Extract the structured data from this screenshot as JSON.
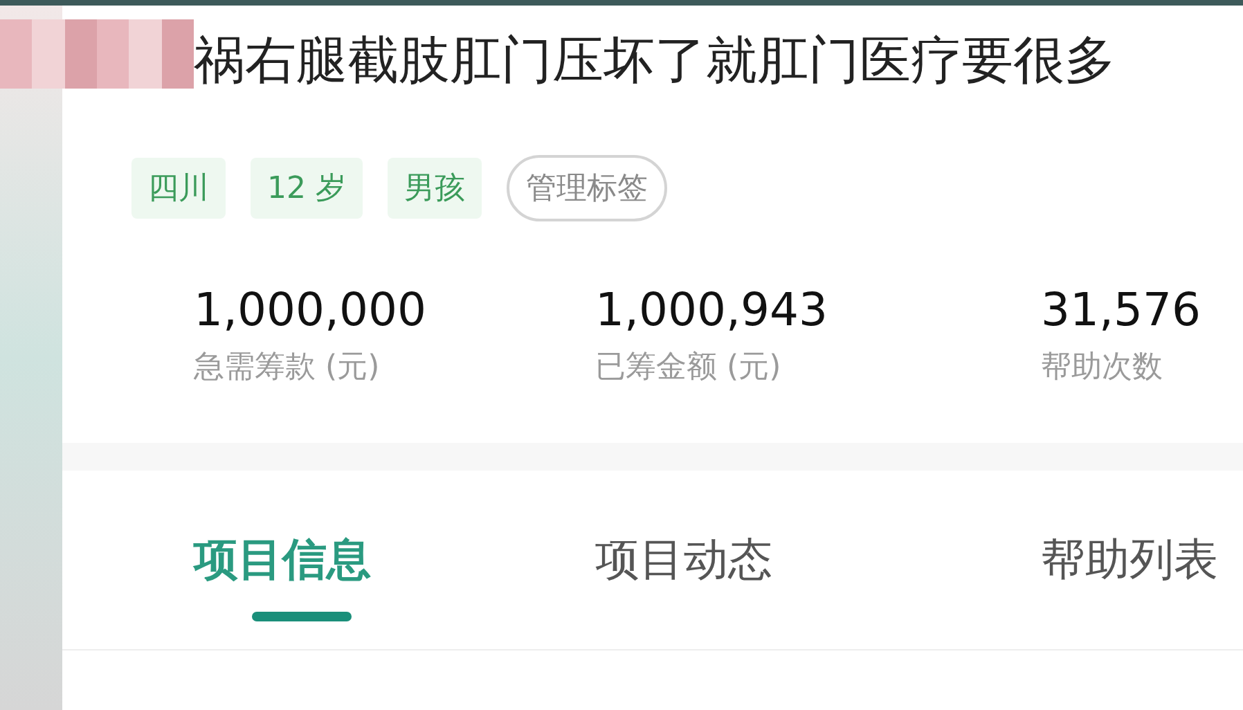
{
  "title": "祸右腿截肢肛门压坏了就肛门医疗要很多",
  "tags": [
    {
      "label": "四川",
      "kind": "info"
    },
    {
      "label": "12 岁",
      "kind": "info"
    },
    {
      "label": "男孩",
      "kind": "info"
    },
    {
      "label": "管理标签",
      "kind": "action"
    }
  ],
  "stats": [
    {
      "value": "1,000,000",
      "label": "急需筹款 (元)"
    },
    {
      "value": "1,000,943",
      "label": "已筹金额 (元)"
    },
    {
      "value": "31,576",
      "label": "帮助次数"
    }
  ],
  "tabs": [
    {
      "label": "项目信息",
      "selected": true
    },
    {
      "label": "项目动态",
      "selected": false
    },
    {
      "label": "帮助列表",
      "selected": false
    }
  ]
}
